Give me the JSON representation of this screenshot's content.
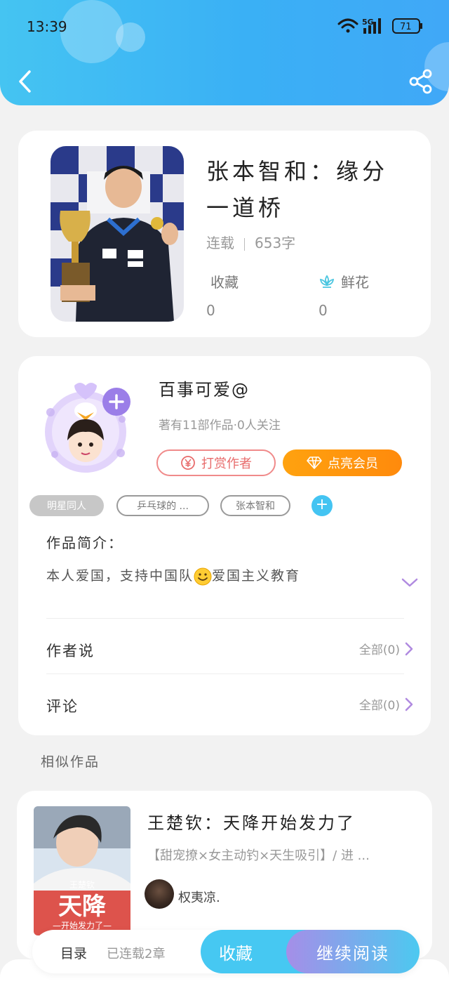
{
  "status_bar": {
    "time": "13:39",
    "battery": "71",
    "network": "5G"
  },
  "book": {
    "title": "张本智和：缘分一道桥",
    "status": "连载",
    "word_count": "653字",
    "favorites_label": "收藏",
    "favorites_count": "0",
    "flowers_label": "鲜花",
    "flowers_count": "0"
  },
  "author": {
    "name": "百事可爱@",
    "stats": "著有11部作品·0人关注",
    "tip_button": "打赏作者",
    "vip_button": "点亮会员"
  },
  "tags": [
    "明星同人",
    "乒乓球的 ...",
    "张本智和"
  ],
  "intro": {
    "title": "作品简介：",
    "text_before": "本人爱国，支持中国队",
    "text_after": "爱国主义教育"
  },
  "author_notes": {
    "label": "作者说",
    "link": "全部(0)"
  },
  "comments": {
    "label": "评论",
    "link": "全部(0)"
  },
  "similar": {
    "section_title": "相似作品",
    "items": [
      {
        "title": "王楚钦：天降开始发力了",
        "tags": "【甜宠撩×女主动钓×天生吸引】/ 进 ...",
        "author": "权夷凉.",
        "cover_text_top": "王楚钦",
        "cover_text_main": "天降",
        "cover_text_sub": "—开始发力了—"
      }
    ]
  },
  "bottom_bar": {
    "toc": "目录",
    "chapters": "已连载2章",
    "favorite": "收藏",
    "continue_reading": "继续阅读"
  },
  "colors": {
    "accent": "#44c4f2",
    "vip": "#ff9a0e",
    "tip": "#e86c6c"
  }
}
